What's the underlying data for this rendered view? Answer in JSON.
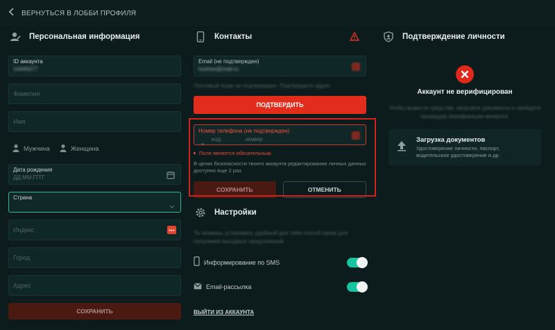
{
  "topbar": {
    "back_label": "ВЕРНУТЬСЯ В ЛОББИ ПРОФИЛЯ"
  },
  "personal": {
    "title": "Персональная информация",
    "account_id_label": "ID аккаунта",
    "account_id_value": "14440077",
    "surname_placeholder": "Фамилия",
    "name_placeholder": "Имя",
    "gender_male": "Мужчина",
    "gender_female": "Женщина",
    "birthdate_label": "Дата рождения",
    "birthdate_placeholder": "ДД.ММ.ГГГГ",
    "country_label": "Страна",
    "index_placeholder": "Индекс",
    "city_placeholder": "Город",
    "address_placeholder": "Адрес",
    "save_label": "СОХРАНИТЬ"
  },
  "contacts": {
    "title": "Контакты",
    "email_label": "Email (не подтвержден)",
    "email_value": "hoshes@mail.ru",
    "hint_text": "Почтовый ящик не подтвержден. Подтвердите адрес.",
    "confirm_label": "ПОДТВЕРДИТЬ",
    "phone_label": "Номер телефона (не подтвержден)",
    "phone_code_placeholder": "код",
    "phone_number_placeholder": "номер",
    "error_text": "Поле является обязательным.",
    "note_text": "В целях безопасности твоего аккаунта редактирование личных данных доступно еще 2 раз.",
    "save_label": "СОХРАНИТЬ",
    "cancel_label": "ОТМЕНИТЬ"
  },
  "settings": {
    "title": "Настройки",
    "hint_text": "Ты можешь установить удобный для тебя способ связи для получения выгодных предложений.",
    "sms_label": "Информирование по SMS",
    "email_label": "Email-рассылка",
    "logout_label": "ВЫЙТИ ИЗ АККАУНТА"
  },
  "verification": {
    "title": "Подтверждение личности",
    "status_text": "Аккаунт не верифицирован",
    "hint_text": "Чтобы вывести средства, загрузите документы и пройдите процедуру верификации аккаунта.",
    "upload_title": "Загрузка документов",
    "upload_desc_line1": "Удостоверение личности, паспорт,",
    "upload_desc_line2": "водительское удостоверение и др."
  },
  "colors": {
    "accent": "#e32d1c",
    "toggle": "#18c3a0",
    "background": "#0c1b1b"
  }
}
